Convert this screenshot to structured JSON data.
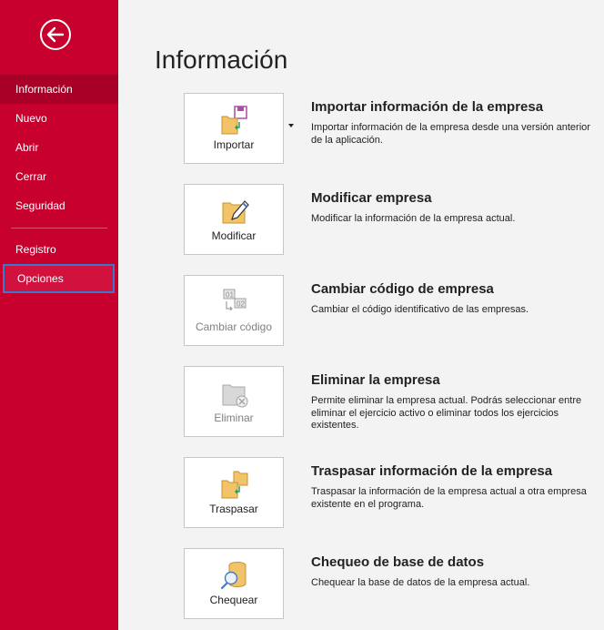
{
  "sidebar": {
    "back_icon": "back-arrow-icon",
    "items": [
      {
        "label": "Información"
      },
      {
        "label": "Nuevo"
      },
      {
        "label": "Abrir"
      },
      {
        "label": "Cerrar"
      },
      {
        "label": "Seguridad"
      },
      {
        "label": "Registro"
      },
      {
        "label": "Opciones"
      }
    ]
  },
  "page": {
    "title": "Información"
  },
  "actions": [
    {
      "button": "Importar",
      "title": "Importar información de la empresa",
      "description": "Importar información de la empresa desde una versión anterior de la aplicación.",
      "icon": "import-icon"
    },
    {
      "button": "Modificar",
      "title": "Modificar empresa",
      "description": "Modificar la información de la empresa actual.",
      "icon": "edit-folder-icon"
    },
    {
      "button": "Cambiar código",
      "title": "Cambiar código de empresa",
      "description": "Cambiar el código identificativo de las empresas.",
      "icon": "change-code-icon"
    },
    {
      "button": "Eliminar",
      "title": "Eliminar la empresa",
      "description": "Permite eliminar la empresa actual. Podrás seleccionar entre eliminar el ejercicio activo o eliminar todos los ejercicios existentes.",
      "icon": "delete-folder-icon"
    },
    {
      "button": "Traspasar",
      "title": "Traspasar información de la empresa",
      "description": "Traspasar la información de la empresa actual a otra empresa existente en el programa.",
      "icon": "transfer-icon"
    },
    {
      "button": "Chequear",
      "title": "Chequeo de base de datos",
      "description": "Chequear la base de datos de la empresa actual.",
      "icon": "check-database-icon"
    }
  ],
  "colors": {
    "sidebar": "#c8002e",
    "sidebar_active": "#a80027",
    "focus_border": "#3a78d2"
  }
}
